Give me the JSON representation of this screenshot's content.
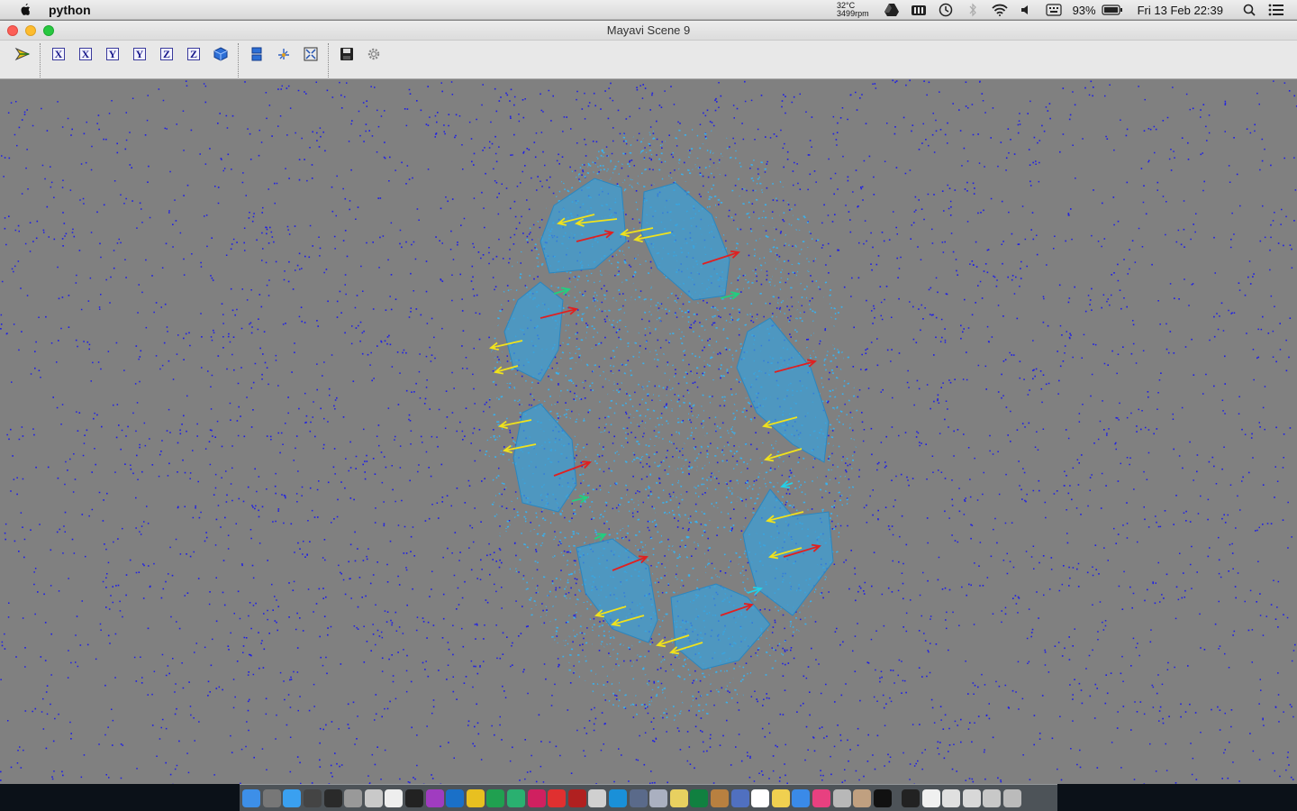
{
  "menubar": {
    "app_name": "python",
    "temperature": "32°C",
    "fan": "3499rpm",
    "battery": "93%",
    "datetime": "Fri 13 Feb  22:39"
  },
  "window": {
    "title": "Mayavi Scene 9"
  },
  "toolbar": {
    "axis_buttons": [
      "X",
      "X",
      "Y",
      "Y",
      "Z",
      "Z"
    ]
  },
  "colors": {
    "scene_bg": "#808080",
    "glyph_blue": "#1e1ee6",
    "surface": "#3aa0d8",
    "arrow_yellow": "#f0e21c",
    "arrow_red": "#e02020",
    "arrow_cyan": "#22d0e8",
    "arrow_green": "#20d080"
  },
  "dock": {
    "icons": [
      "finder-icon",
      "launchpad-icon",
      "safari-icon",
      "mission-control-icon",
      "activity-monitor-icon",
      "disk-utility-icon",
      "preview-icon",
      "textedit-icon",
      "terminal-icon",
      "colorsync-icon",
      "xcode-icon",
      "scripts-icon",
      "mathematica-icon",
      "grapher-icon",
      "flashcard-icon",
      "adobe-icon",
      "ps-icon",
      "screenshot-icon",
      "network-icon",
      "box-icon",
      "cloud-icon",
      "notes-icon",
      "excel-icon",
      "books-icon",
      "photos-icon",
      "calendar-icon",
      "stickies-icon",
      "safari-blue-icon",
      "itunes-icon",
      "app-store-icon",
      "maps-icon",
      "terminal-dark-icon",
      "contrast-icon",
      "document-icon",
      "window-icon",
      "window2-icon",
      "drive-icon",
      "trash-icon"
    ]
  }
}
